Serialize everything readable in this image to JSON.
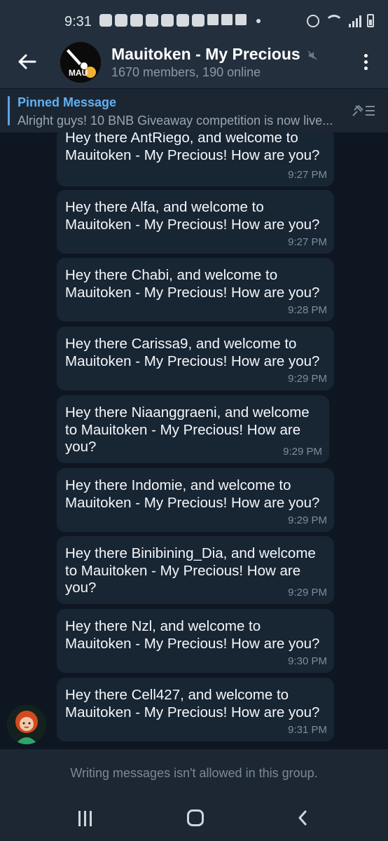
{
  "status_bar": {
    "time": "9:31"
  },
  "header": {
    "title": "Mauitoken - My Precious",
    "subtitle": "1670 members, 190 online",
    "avatar_text": "MAU"
  },
  "pinned": {
    "title": "Pinned Message",
    "text": "Alright guys! 10 BNB Giveaway competition is now live..."
  },
  "messages": [
    {
      "text": "Hey there AntRiego, and welcome to\nMauitoken - My Precious! How are you?",
      "time": "9:27 PM"
    },
    {
      "text": "Hey there Alfa, and welcome to\nMauitoken - My Precious! How are you?",
      "time": "9:27 PM"
    },
    {
      "text": "Hey there Chabi, and welcome to\nMauitoken - My Precious! How are you?",
      "time": "9:28 PM"
    },
    {
      "text": "Hey there Carissa9, and welcome to\nMauitoken - My Precious! How are you?",
      "time": "9:29 PM"
    },
    {
      "text": "Hey there Niaanggraeni, and welcome\nto Mauitoken - My Precious! How are\nyou?",
      "time": "9:29 PM"
    },
    {
      "text": "Hey there Indomie, and welcome to\nMauitoken - My Precious! How are you?",
      "time": "9:29 PM"
    },
    {
      "text": "Hey there Binibining_Dia, and welcome\nto Mauitoken - My Precious! How are\nyou?",
      "time": "9:29 PM"
    },
    {
      "text": "Hey there Nzl, and welcome to\nMauitoken - My Precious! How are you?",
      "time": "9:30 PM"
    },
    {
      "text": "Hey there Cell427, and welcome to\nMauitoken - My Precious! How are you?",
      "time": "9:31 PM"
    }
  ],
  "footer": {
    "notice": "Writing messages isn't allowed in this group."
  },
  "icons": {
    "back": "arrow-left-icon",
    "menu": "more-vertical-icon",
    "mute": "mute-icon",
    "pinned_list": "pinned-list-icon"
  },
  "colors": {
    "background": "#0e1621",
    "header": "#232f3d",
    "bubble": "#182533",
    "accent": "#62b0f2"
  }
}
